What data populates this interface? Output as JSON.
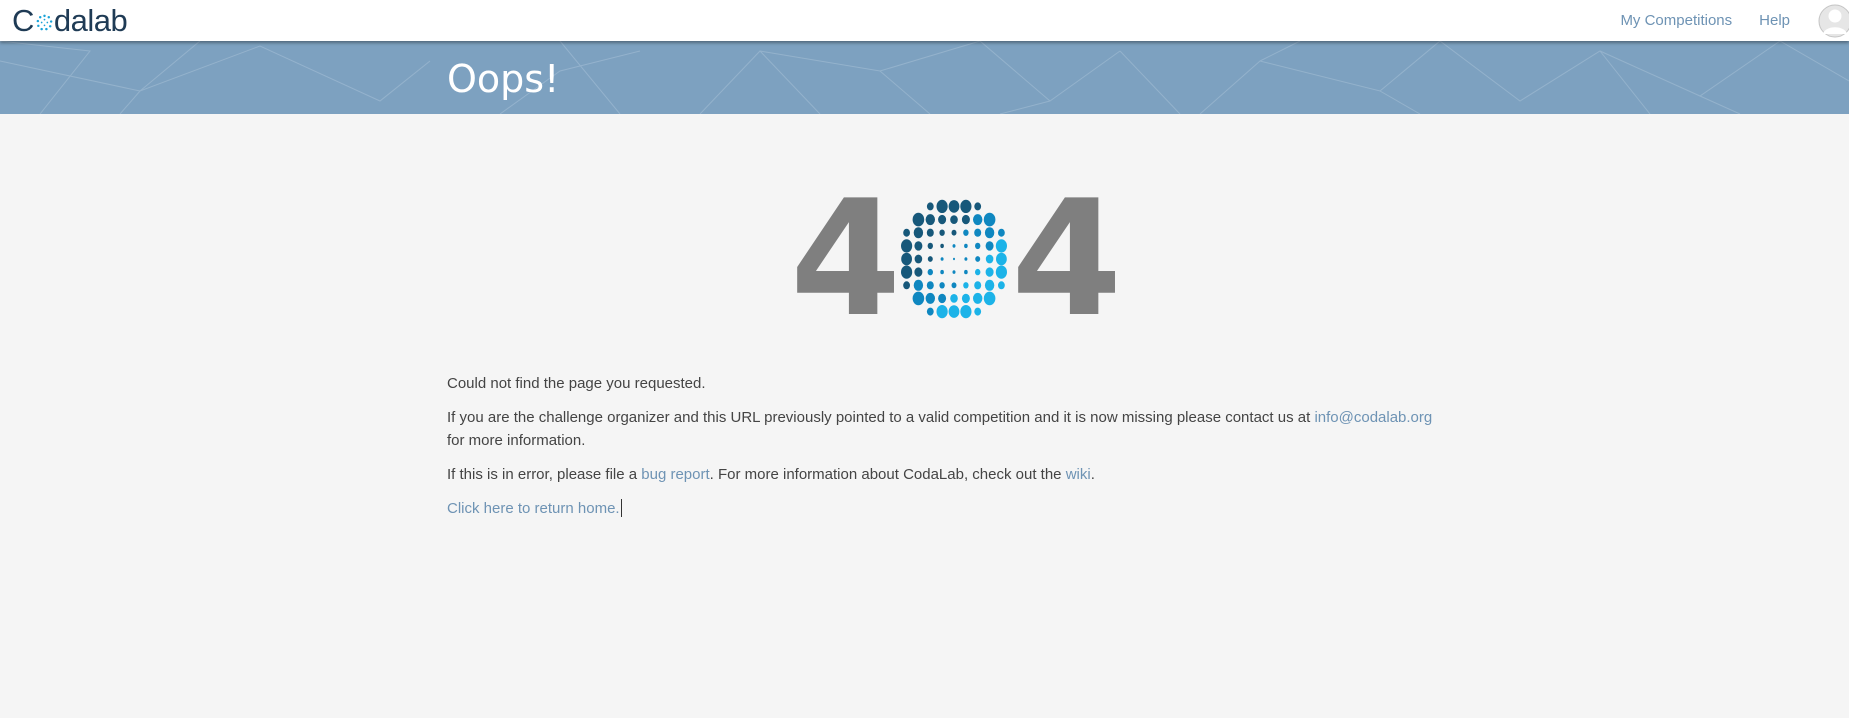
{
  "header": {
    "logo": {
      "first": "C",
      "rest": "dalab"
    },
    "nav": {
      "my_competitions": "My Competitions",
      "help": "Help"
    }
  },
  "banner": {
    "title": "Oops!"
  },
  "error_graphic": {
    "left_digit": "4",
    "right_digit": "4",
    "orb_colors": [
      "#17587a",
      "#0f87c0",
      "#1cb3e8"
    ],
    "digit_color": "#7f7f7f"
  },
  "content": {
    "line1": "Could not find the page you requested.",
    "para2_before": "If you are the challenge organizer and this URL previously pointed to a valid competition and it is now missing please contact us at ",
    "para2_email": "info@codalab.org",
    "para2_after": " for more information.",
    "para3_before": "If this is in error, please file a ",
    "para3_bug_link": "bug report",
    "para3_middle": ". For more information about CodaLab, check out the ",
    "para3_wiki_link": "wiki",
    "para3_end": ".",
    "return_home": "Click here to return home."
  },
  "colors": {
    "link": "#6e93b4",
    "banner": "#7da1c0",
    "background": "#f5f5f5"
  }
}
